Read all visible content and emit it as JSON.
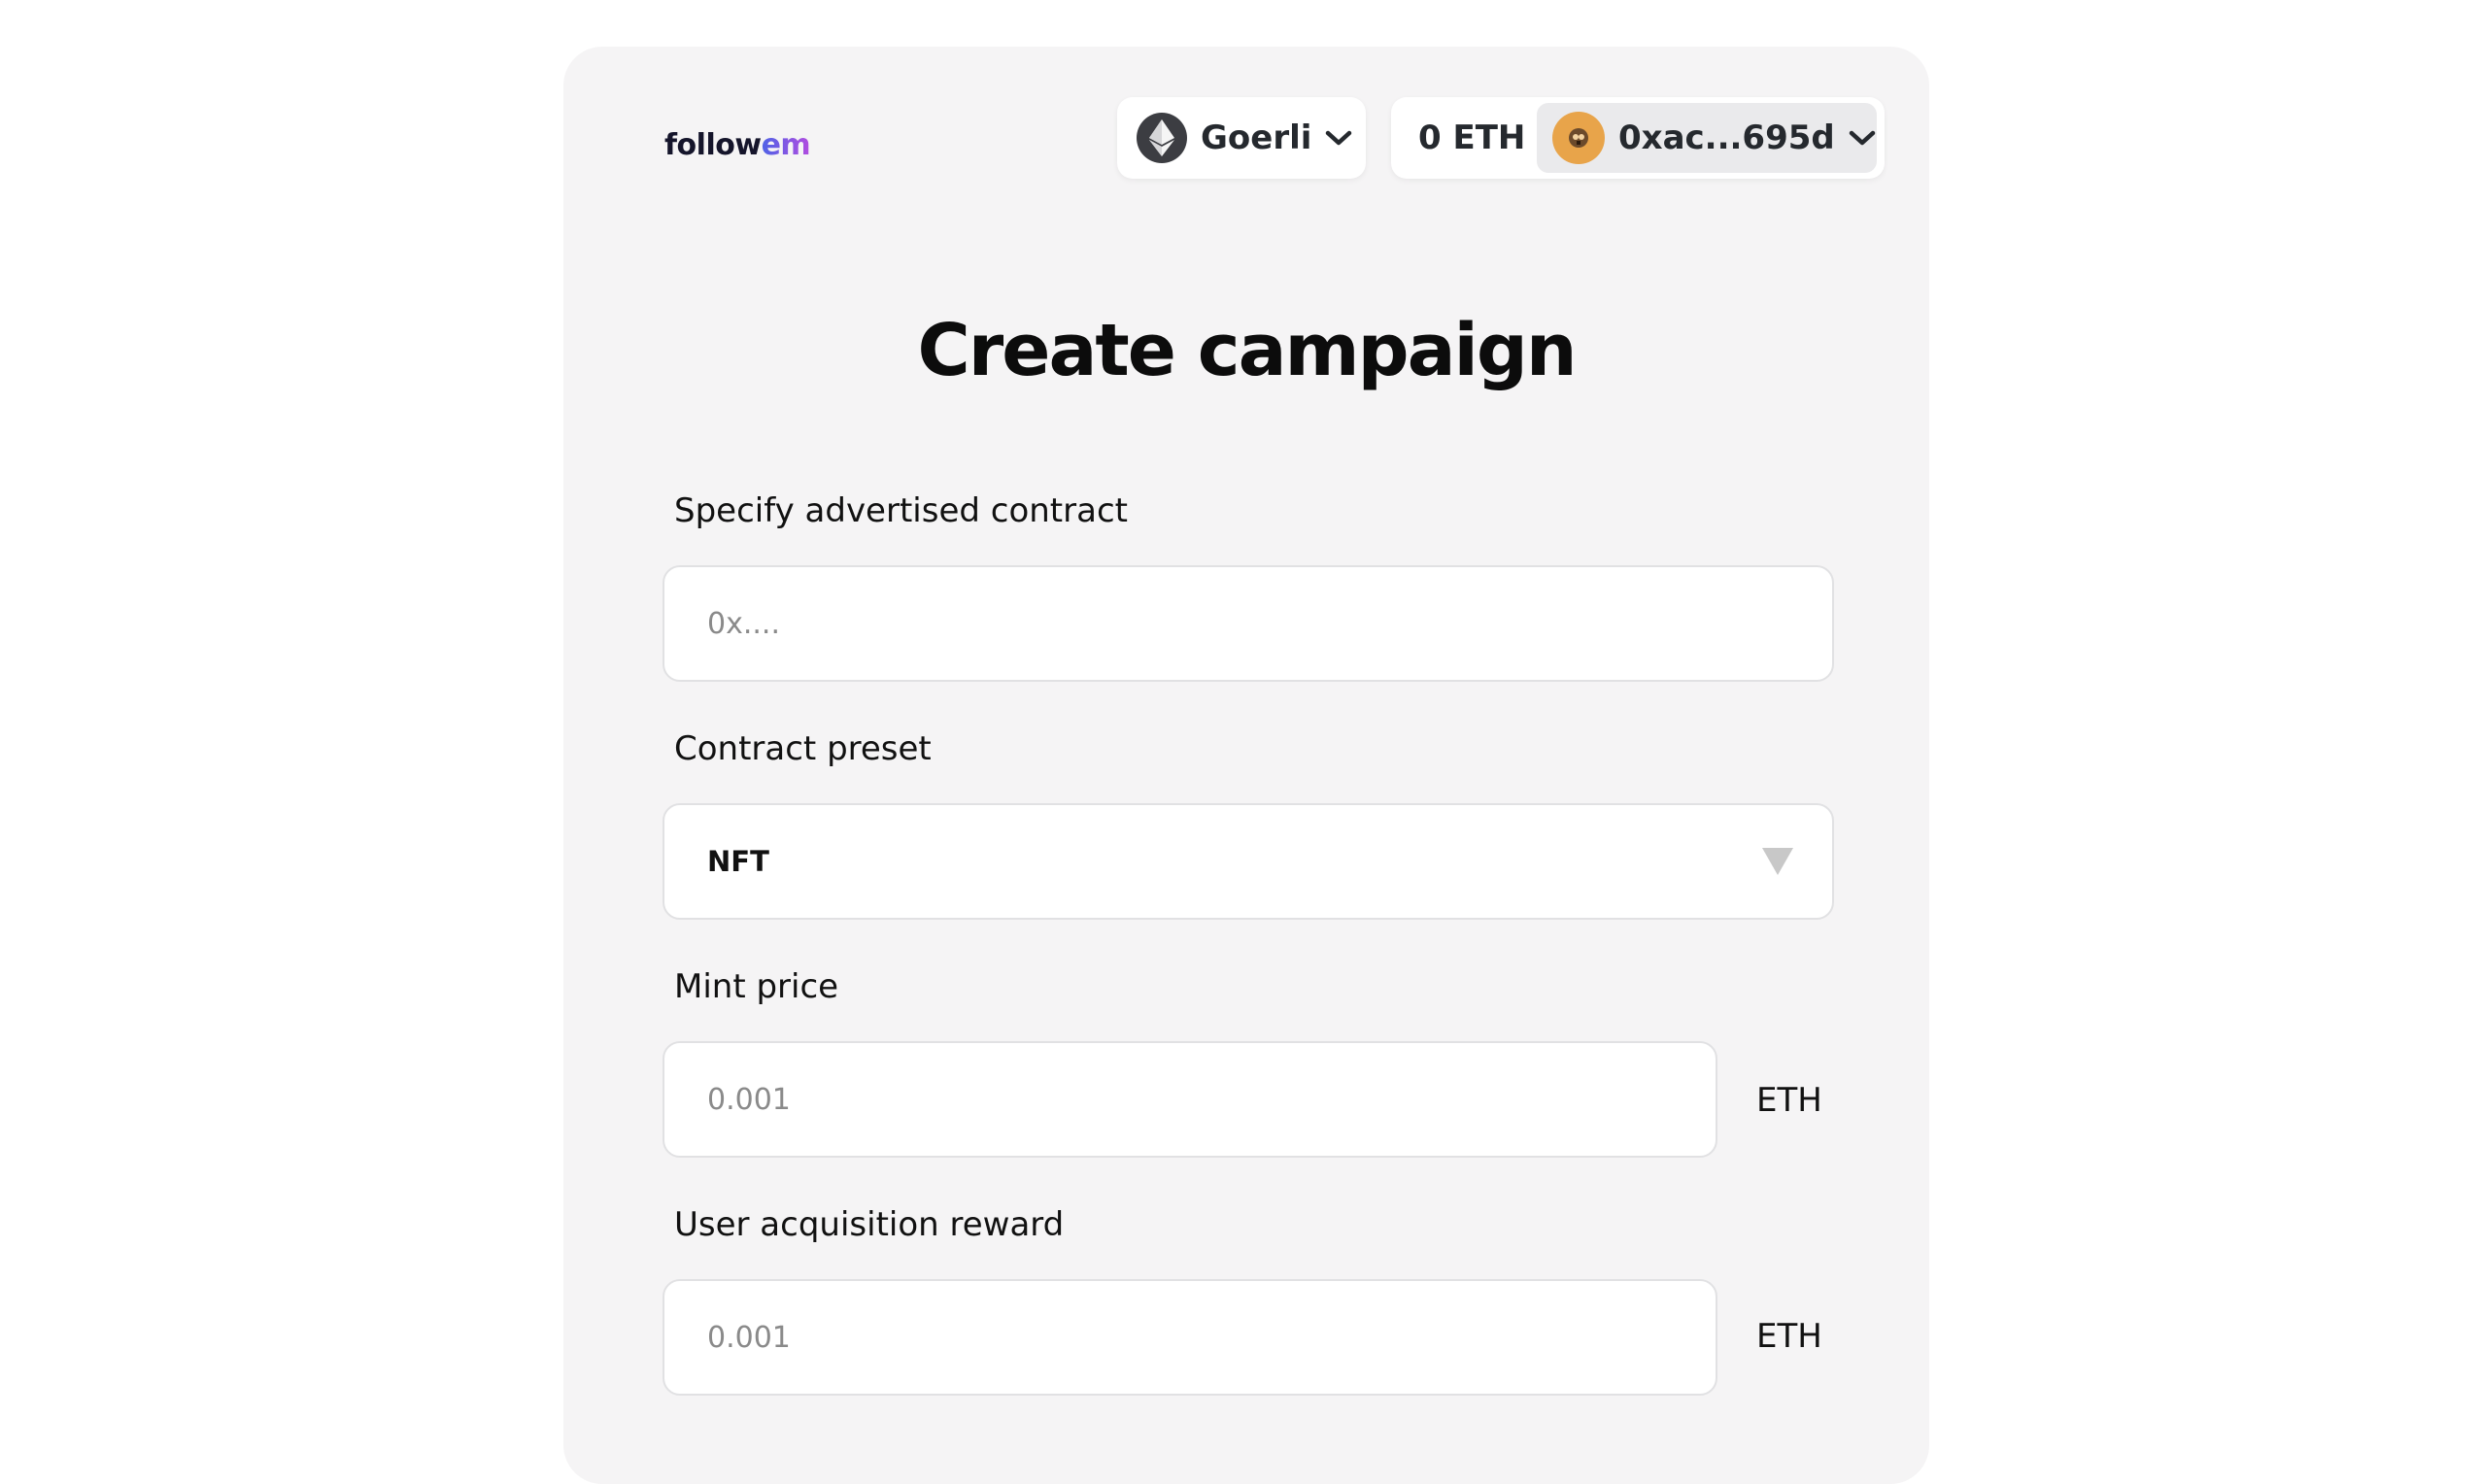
{
  "header": {
    "logo_part1": "follow",
    "logo_part2": "em",
    "network": {
      "name": "Goerli",
      "icon": "ethereum-icon"
    },
    "balance": "0 ETH",
    "account": {
      "address": "0xac...695d",
      "avatar_icon": "avatar-emoji"
    }
  },
  "form": {
    "title": "Create campaign",
    "contract": {
      "label": "Specify advertised contract",
      "placeholder": "0x....",
      "value": ""
    },
    "preset": {
      "label": "Contract preset",
      "value": "NFT"
    },
    "mint_price": {
      "label": "Mint price",
      "placeholder": "0.001",
      "unit": "ETH"
    },
    "reward": {
      "label": "User acquisition reward",
      "placeholder": "0.001",
      "unit": "ETH"
    }
  },
  "colors": {
    "card_bg": "#f5f4f5",
    "logo_dark": "#15152b",
    "logo_gradient_start": "#4f63e6",
    "logo_gradient_end": "#b24ce0",
    "avatar_bg": "#e8a44a"
  }
}
